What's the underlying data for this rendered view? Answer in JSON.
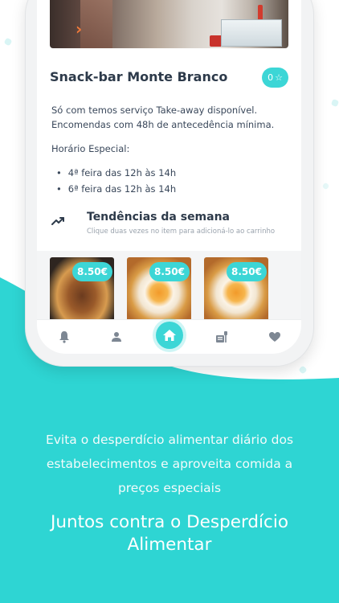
{
  "colors": {
    "accent": "#3cd6d6",
    "text": "#2d3a4a",
    "background_wave": "#2ed5d3"
  },
  "restaurant": {
    "name": "Snack-bar Monte Branco",
    "rating": "0",
    "description_line1": "Só com temos serviço Take-away disponível.",
    "description_line2": "Encomendas com 48h de antecedência mínima.",
    "special_hours_label": "Horário Especial:",
    "special_hours": [
      "4ª feira das 12h às 14h",
      "6ª feira das 12h às 14h"
    ]
  },
  "trends": {
    "title": "Tendências da semana",
    "subtitle": "Clique duas vezes no item para adicioná-lo ao carrinho",
    "items": [
      {
        "image": "burger-and-fries-photo",
        "price": "8.50€"
      },
      {
        "image": "fried-egg-and-fries-photo",
        "price": "8.50€"
      },
      {
        "image": "fried-egg-and-fries-photo",
        "price": "8.50€"
      }
    ]
  },
  "navbar": {
    "items": [
      "bell-icon",
      "user-icon",
      "home-icon",
      "menu-food-icon",
      "heart-icon"
    ],
    "active": "home-icon"
  },
  "promo": {
    "tagline_line1": "Evita o desperdício alimentar diário dos",
    "tagline_line2": "estabelecimentos e aproveita comida a",
    "tagline_line3": "preços especiais",
    "slogan_line1": "Juntos contra o Desperdício",
    "slogan_line2": "Alimentar"
  }
}
